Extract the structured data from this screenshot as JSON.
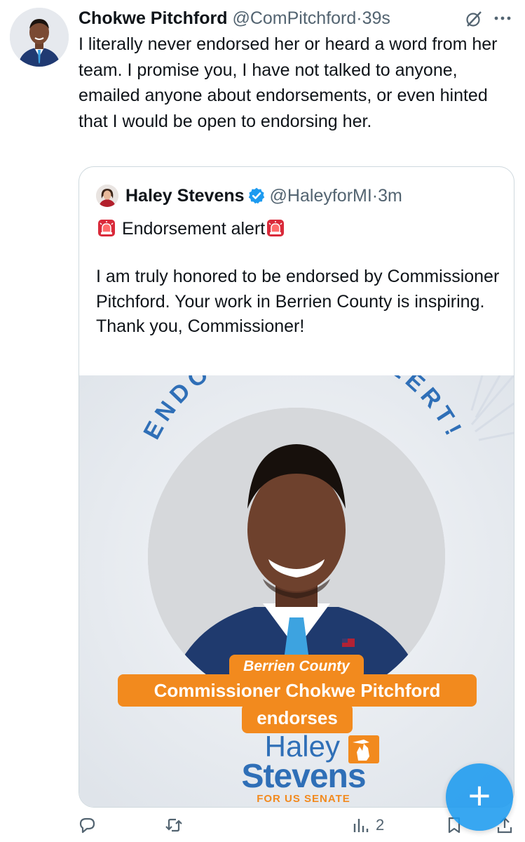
{
  "tweet": {
    "author_name": "Chokwe Pitchford",
    "author_handle": "@ComPitchford",
    "separator": "·",
    "time": "39s",
    "text": "I literally never endorsed her or heard a word from her team. I promise you, I have not talked to anyone, emailed anyone about endorsements, or even hinted that I would be open to endorsing her."
  },
  "quoted_tweet": {
    "author_name": "Haley Stevens",
    "author_handle": "@HaleyforMI",
    "separator": "·",
    "time": "3m",
    "alert_text": "Endorsement alert",
    "body": "I am truly honored to be endorsed by Commissioner Pitchford. Your work in Berrien County is inspiring. Thank you, Commissioner!",
    "image": {
      "arc_text": "ENDORSEMENT ALERT!",
      "county_label": "Berrien County",
      "headline": "Commissioner Chokwe Pitchford",
      "verb": "endorses",
      "brand_first": "Haley",
      "brand_last": "Stevens",
      "brand_tagline": "FOR US SENATE"
    }
  },
  "actions": {
    "views_count": "2"
  },
  "icons": {
    "grok": "grok-icon",
    "more": "more-icon",
    "verified": "verified-badge-icon",
    "siren": "siren-icon",
    "reply": "reply-icon",
    "retweet": "retweet-icon",
    "like": "like-icon",
    "views": "views-icon",
    "bookmark": "bookmark-icon",
    "share": "share-icon",
    "compose": "compose-plus-icon"
  },
  "colors": {
    "accent": "#1d9bf0",
    "secondary_text": "#536471",
    "brand_blue": "#2f6fb7",
    "brand_orange": "#f28a1e",
    "border": "#cfd9de"
  }
}
